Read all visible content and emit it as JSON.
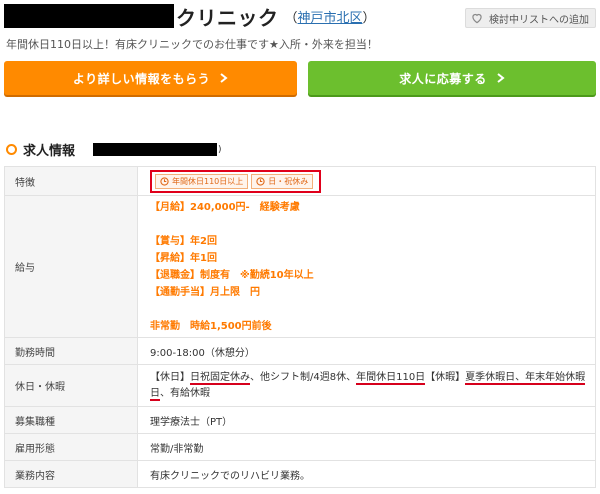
{
  "header": {
    "title_suffix": "クリニック",
    "location_open": "（",
    "location": "神戸市北区",
    "location_close": "）",
    "favorite_label": "検討中リストへの追加",
    "subtitle": "年間休日110日以上！有床クリニックでのお仕事です★入所・外来を担当！"
  },
  "cta": {
    "info_label": "より詳しい情報をもらう",
    "apply_label": "求人に応募する"
  },
  "section": {
    "title": "求人情報",
    "title_tail": ")"
  },
  "table": {
    "features": {
      "key": "特徴",
      "tags": [
        "年間休日110日以上",
        "日・祝休み"
      ]
    },
    "salary": {
      "key": "給与",
      "lines": [
        "【月給】240,000円-　経験考慮",
        "",
        "【賞与】年2回",
        "【昇給】年1回",
        "【退職金】制度有　※勤続10年以上",
        "【通勤手当】月上限　円",
        "",
        "非常勤　時給1,500円前後"
      ]
    },
    "hours": {
      "key": "勤務時間",
      "value": "9:00-18:00（休憩分）"
    },
    "holidays": {
      "key": "休日・休暇",
      "p1": "【休日】",
      "p2": "日祝固定休み",
      "p3": "、他シフト制/4週8休、",
      "p4": "年間休日110日",
      "p5": "【休暇】",
      "p6": "夏季休暇日、年末年始休暇",
      "p7": "日",
      "p8": "、有給休暇"
    },
    "job_type": {
      "key": "募集職種",
      "value": "理学療法士（PT）"
    },
    "employment": {
      "key": "雇用形態",
      "value": "常勤/非常勤"
    },
    "duties": {
      "key": "業務内容",
      "value": "有床クリニックでのリハビリ業務。"
    }
  },
  "colors": {
    "orange": "#ff8a00",
    "green": "#6cbf2e",
    "highlight_red": "#e0001b",
    "link_blue": "#2a6fb0"
  }
}
